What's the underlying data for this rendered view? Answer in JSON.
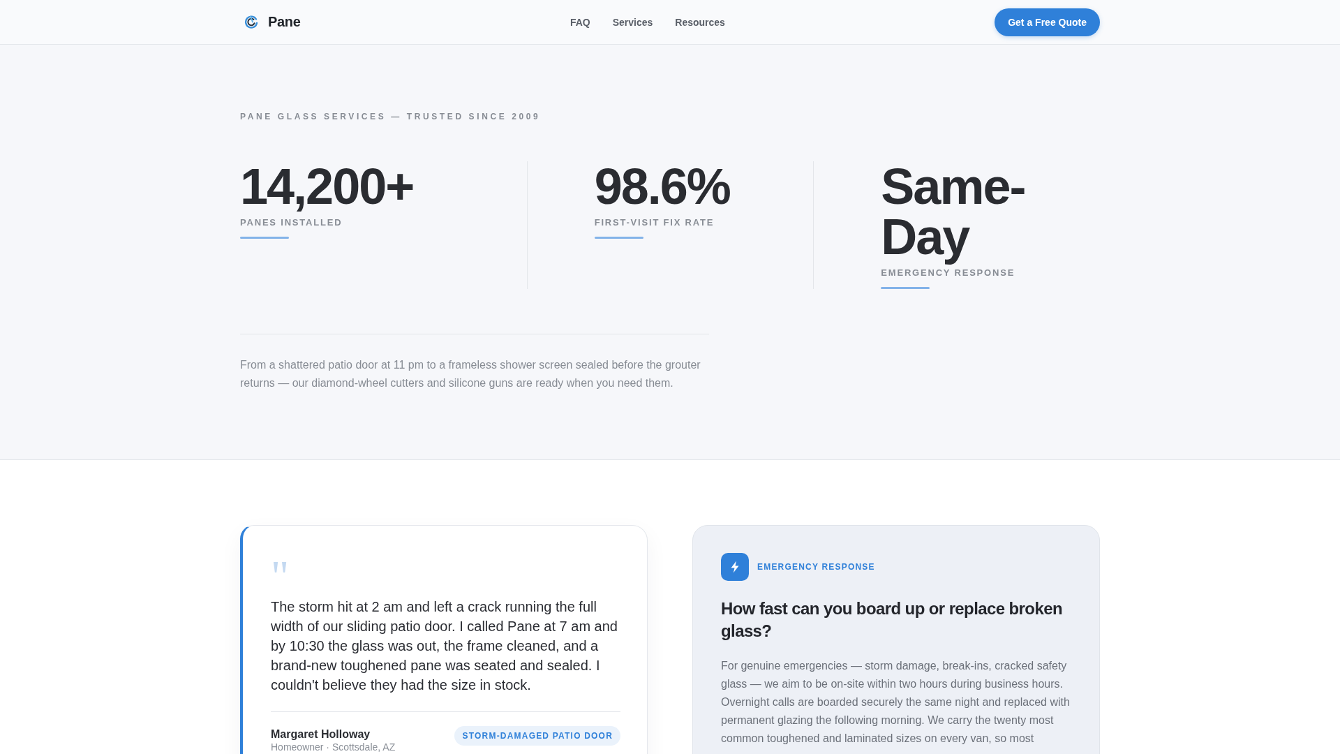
{
  "header": {
    "brand": "Pane",
    "nav": [
      {
        "label": "FAQ"
      },
      {
        "label": "Services"
      },
      {
        "label": "Resources"
      }
    ],
    "cta": "Get a Free Quote"
  },
  "hero": {
    "eyebrow": "PANE GLASS SERVICES — TRUSTED SINCE 2009",
    "stats": [
      {
        "value": "14,200+",
        "label": "PANES INSTALLED"
      },
      {
        "value": "98.6%",
        "label": "FIRST-VISIT FIX RATE"
      },
      {
        "value": "Same-Day",
        "label": "EMERGENCY RESPONSE"
      }
    ],
    "intro": "From a shattered patio door at 11 pm to a frameless shower screen sealed before the grouter returns — our diamond-wheel cutters and silicone guns are ready when you need them."
  },
  "testimonial": {
    "quote_mark": "\"",
    "quote": "The storm hit at 2 am and left a crack running the full width of our sliding patio door. I called Pane at 7 am and by 10:30 the glass was out, the frame cleaned, and a brand-new toughened pane was seated and sealed. I couldn't believe they had the size in stock.",
    "name": "Margaret Holloway",
    "role": "Homeowner · Scottsdale, AZ",
    "tag": "STORM-DAMAGED PATIO DOOR"
  },
  "faq": {
    "eyebrow": "EMERGENCY RESPONSE",
    "question": "How fast can you board up or replace broken glass?",
    "answer": "For genuine emergencies — storm damage, break-ins, cracked safety glass — we aim to be on-site within two hours during business hours. Overnight calls are boarded securely the same night and replaced with permanent glazing the following morning. We carry the twenty most common toughened and laminated sizes on every van, so most"
  }
}
